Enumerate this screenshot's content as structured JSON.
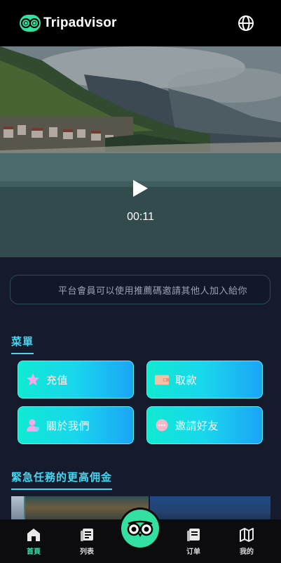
{
  "header": {
    "brand": "Tripadvisor",
    "language_icon": "globe-icon"
  },
  "video": {
    "time": "00:11",
    "play_icon": "play-icon"
  },
  "notice": {
    "text": "平台會員可以使用推薦碼邀請其他人加入給你"
  },
  "menu": {
    "title": "菜單",
    "items": [
      {
        "label": "充值",
        "icon": "star-icon"
      },
      {
        "label": "取款",
        "icon": "wallet-icon"
      },
      {
        "label": "關於我們",
        "icon": "user-icon"
      },
      {
        "label": "邀請好友",
        "icon": "chat-icon"
      }
    ]
  },
  "tasks": {
    "title": "緊急任務的更高佣金"
  },
  "bottom_nav": {
    "items": [
      {
        "label": "首頁",
        "icon": "home-icon",
        "active": true
      },
      {
        "label": "列表",
        "icon": "list-icon",
        "active": false
      },
      {
        "label": "订单",
        "icon": "order-icon",
        "active": false
      },
      {
        "label": "我的",
        "icon": "map-icon",
        "active": false
      }
    ],
    "center_icon": "tripadvisor-owl-icon"
  },
  "colors": {
    "accent": "#43d7f2",
    "brand_green": "#34e0a1",
    "background": "#151b2c"
  }
}
